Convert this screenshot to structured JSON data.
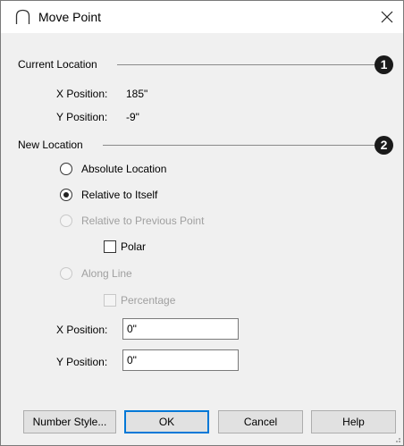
{
  "window": {
    "title": "Move Point",
    "icon": "arc-icon",
    "close_icon": "close-icon"
  },
  "current_location": {
    "label": "Current Location",
    "callout": "1",
    "x_label": "X Position:",
    "x_value": "185\"",
    "y_label": "Y Position:",
    "y_value": "-9\""
  },
  "new_location": {
    "label": "New Location",
    "callout": "2",
    "absolute_label": "Absolute Location",
    "relative_itself_label": "Relative to Itself",
    "relative_previous_label": "Relative to Previous Point",
    "polar_label": "Polar",
    "along_line_label": "Along Line",
    "percentage_label": "Percentage",
    "x_label": "X Position:",
    "x_value": "0\"",
    "y_label": "Y Position:",
    "y_value": "0\"",
    "selected": "Relative to Itself"
  },
  "buttons": {
    "number_style": "Number Style...",
    "ok": "OK",
    "cancel": "Cancel",
    "help": "Help"
  },
  "colors": {
    "accent": "#0078d7",
    "disabled_text": "#a0a0a0"
  }
}
